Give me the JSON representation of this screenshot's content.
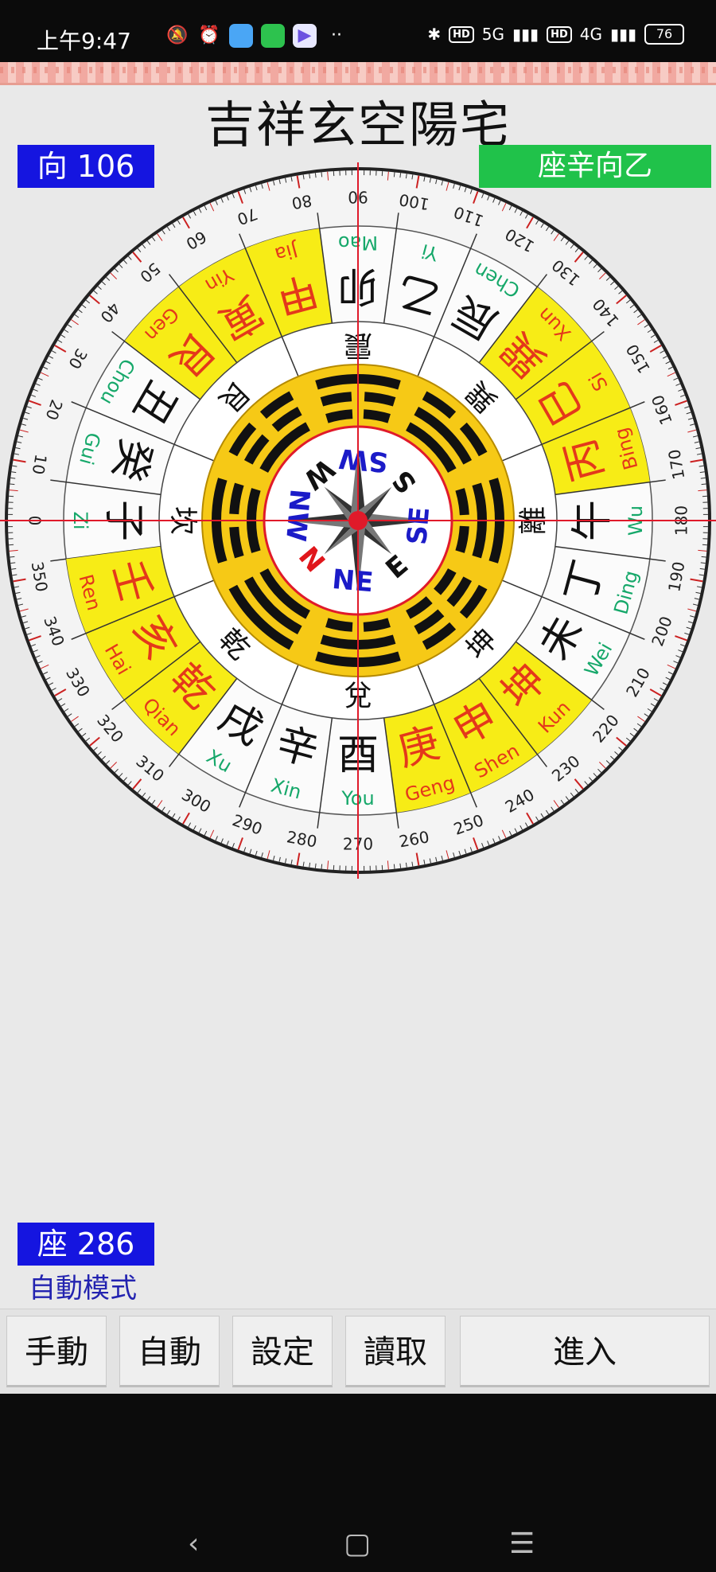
{
  "status_bar": {
    "time": "上午9:47",
    "battery": "76",
    "net1": "5G",
    "net2": "4G",
    "hd": "HD"
  },
  "app": {
    "title": "吉祥玄空陽宅",
    "direction_badge": "向 106",
    "sitting_badge": "座辛向乙",
    "seat_badge": "座 286",
    "mode_label": "自動模式",
    "buttons": [
      "手動",
      "自動",
      "設定",
      "讀取",
      "進入"
    ]
  },
  "compass": {
    "degree_labels": [
      "0",
      "10",
      "20",
      "30",
      "40",
      "50",
      "60",
      "70",
      "80",
      "90",
      "100",
      "110",
      "120",
      "130",
      "140",
      "150",
      "160",
      "170",
      "180",
      "190",
      "200",
      "210",
      "220",
      "230",
      "240",
      "250",
      "260",
      "270",
      "280",
      "290",
      "300",
      "310",
      "320",
      "330",
      "340",
      "350"
    ],
    "mountains": [
      {
        "hanzi": "子",
        "pinyin": "Zi",
        "highlight": false
      },
      {
        "hanzi": "癸",
        "pinyin": "Gui",
        "highlight": false
      },
      {
        "hanzi": "丑",
        "pinyin": "Chou",
        "highlight": false
      },
      {
        "hanzi": "艮",
        "pinyin": "Gen",
        "highlight": true
      },
      {
        "hanzi": "寅",
        "pinyin": "Yin",
        "highlight": true
      },
      {
        "hanzi": "甲",
        "pinyin": "Jia",
        "highlight": true
      },
      {
        "hanzi": "卯",
        "pinyin": "Mao",
        "highlight": false
      },
      {
        "hanzi": "乙",
        "pinyin": "Yi",
        "highlight": false
      },
      {
        "hanzi": "辰",
        "pinyin": "Chen",
        "highlight": false
      },
      {
        "hanzi": "巽",
        "pinyin": "Xun",
        "highlight": true
      },
      {
        "hanzi": "巳",
        "pinyin": "Si",
        "highlight": true
      },
      {
        "hanzi": "丙",
        "pinyin": "Bing",
        "highlight": true
      },
      {
        "hanzi": "午",
        "pinyin": "Wu",
        "highlight": false
      },
      {
        "hanzi": "丁",
        "pinyin": "Ding",
        "highlight": false
      },
      {
        "hanzi": "未",
        "pinyin": "Wei",
        "highlight": false
      },
      {
        "hanzi": "坤",
        "pinyin": "Kun",
        "highlight": true
      },
      {
        "hanzi": "申",
        "pinyin": "Shen",
        "highlight": true
      },
      {
        "hanzi": "庚",
        "pinyin": "Geng",
        "highlight": true
      },
      {
        "hanzi": "酉",
        "pinyin": "You",
        "highlight": false
      },
      {
        "hanzi": "辛",
        "pinyin": "Xin",
        "highlight": false
      },
      {
        "hanzi": "戌",
        "pinyin": "Xu",
        "highlight": false
      },
      {
        "hanzi": "乾",
        "pinyin": "Qian",
        "highlight": true
      },
      {
        "hanzi": "亥",
        "pinyin": "Hai",
        "highlight": true
      },
      {
        "hanzi": "壬",
        "pinyin": "Ren",
        "highlight": true
      }
    ],
    "trigrams": [
      "坎",
      "艮",
      "震",
      "巽",
      "離",
      "坤",
      "兌",
      "乾"
    ],
    "center_directions": [
      {
        "label": "N",
        "color": "#e0161b"
      },
      {
        "label": "NE",
        "color": "#1b1bc8"
      },
      {
        "label": "E",
        "color": "#111111"
      },
      {
        "label": "SE",
        "color": "#1b1bc8"
      },
      {
        "label": "S",
        "color": "#111111"
      },
      {
        "label": "SW",
        "color": "#1b1bc8"
      },
      {
        "label": "W",
        "color": "#111111"
      },
      {
        "label": "NW",
        "color": "#1b1bc8"
      }
    ],
    "colors": {
      "highlight": "#f7ec16",
      "red_text": "#e4381b",
      "pinyin_green": "#16a86a",
      "trigram_ring": "#f6c916",
      "needle": "#e01a2a"
    }
  }
}
